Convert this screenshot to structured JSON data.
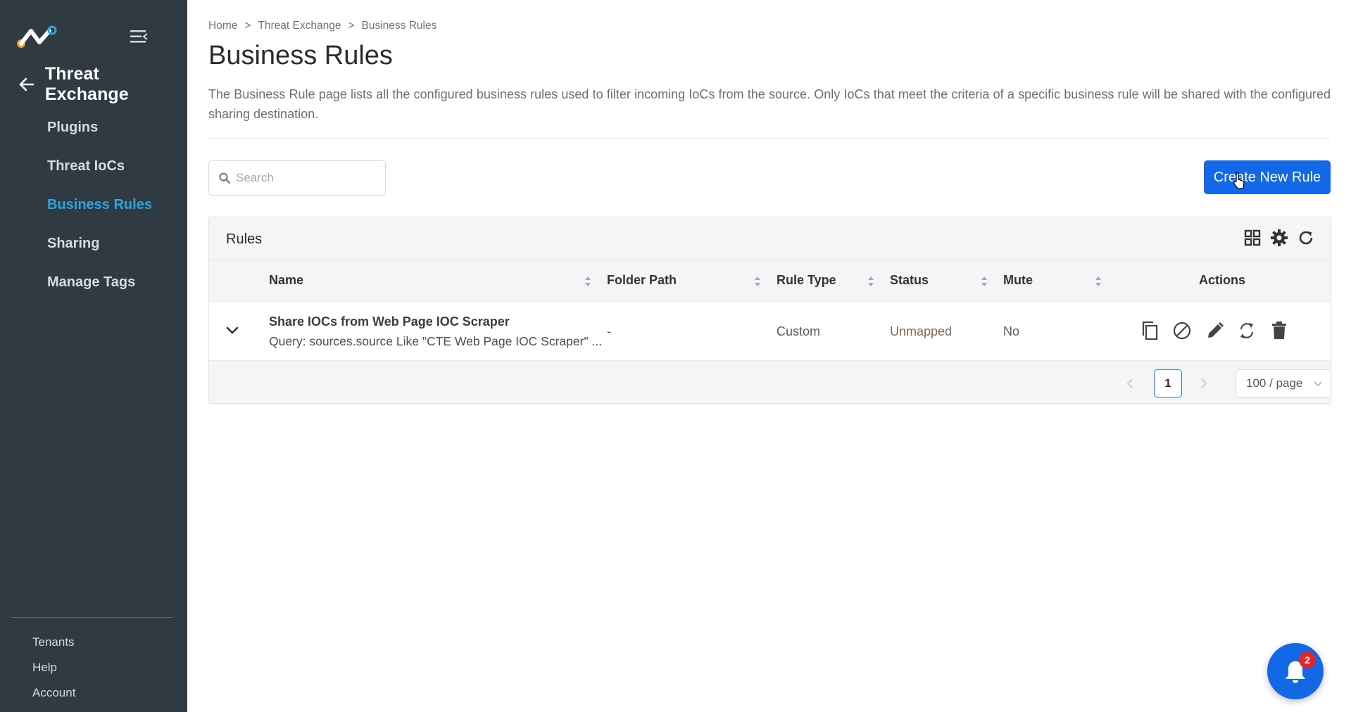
{
  "sidebar": {
    "section_title": "Threat Exchange",
    "items": [
      {
        "label": "Plugins",
        "active": false
      },
      {
        "label": "Threat IoCs",
        "active": false
      },
      {
        "label": "Business Rules",
        "active": true
      },
      {
        "label": "Sharing",
        "active": false
      },
      {
        "label": "Manage Tags",
        "active": false
      }
    ],
    "bottom_items": [
      {
        "label": "Tenants"
      },
      {
        "label": "Help"
      },
      {
        "label": "Account"
      }
    ]
  },
  "breadcrumb": [
    "Home",
    "Threat Exchange",
    "Business Rules"
  ],
  "breadcrumb_separator": ">",
  "page": {
    "title": "Business Rules",
    "description": "The Business Rule page lists all the configured business rules used to filter incoming IoCs from the source. Only IoCs that meet the criteria of a specific business rule will be shared with the configured sharing destination."
  },
  "search": {
    "placeholder": "Search",
    "value": ""
  },
  "create_button": {
    "label": "Create New Rule"
  },
  "rules_card": {
    "title": "Rules",
    "columns": [
      "Name",
      "Folder Path",
      "Rule Type",
      "Status",
      "Mute",
      "Actions"
    ],
    "rows": [
      {
        "name": "Share IOCs from Web Page IOC Scraper",
        "query": "Query: sources.source Like \"CTE Web Page IOC Scraper\" ...",
        "folder_path": "-",
        "rule_type": "Custom",
        "status": "Unmapped",
        "mute": "No"
      }
    ],
    "pagination": {
      "current_page": "1",
      "page_size": "100 / page"
    }
  },
  "notifications": {
    "count": "2"
  },
  "colors": {
    "sidebar_bg": "#2f3a43",
    "accent": "#1268e6",
    "active_nav": "#2aa6e0",
    "badge": "#e5252a"
  },
  "icons": [
    "app-logo",
    "menu-collapse-icon",
    "back-arrow-icon",
    "search-icon",
    "grid-view-icon",
    "gear-icon",
    "refresh-icon",
    "chevron-down-icon",
    "copy-icon",
    "disable-icon",
    "edit-icon",
    "sync-icon",
    "trash-icon",
    "bell-icon"
  ]
}
